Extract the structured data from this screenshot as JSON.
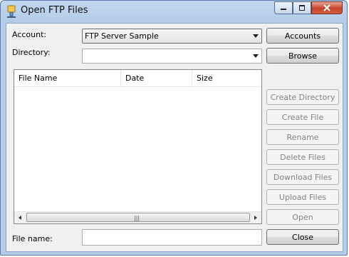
{
  "window": {
    "title": "Open FTP Files"
  },
  "form": {
    "account_label": "Account:",
    "account_value": "FTP Server Sample",
    "directory_label": "Directory:",
    "directory_value": "",
    "filename_label": "File name:",
    "filename_value": ""
  },
  "file_list": {
    "columns": [
      "File Name",
      "Date",
      "Size"
    ],
    "rows": [],
    "scroll_grip": "|||"
  },
  "buttons": {
    "accounts": "Accounts",
    "browse": "Browse",
    "create_directory": "Create Directory",
    "create_file": "Create File",
    "rename": "Rename",
    "delete_files": "Delete Files",
    "download_files": "Download Files",
    "upload_files": "Upload Files",
    "open": "Open",
    "close": "Close"
  },
  "colors": {
    "title_gradient": "#c3d7ef",
    "close_button": "#c7452b",
    "disabled_text": "#838383"
  }
}
